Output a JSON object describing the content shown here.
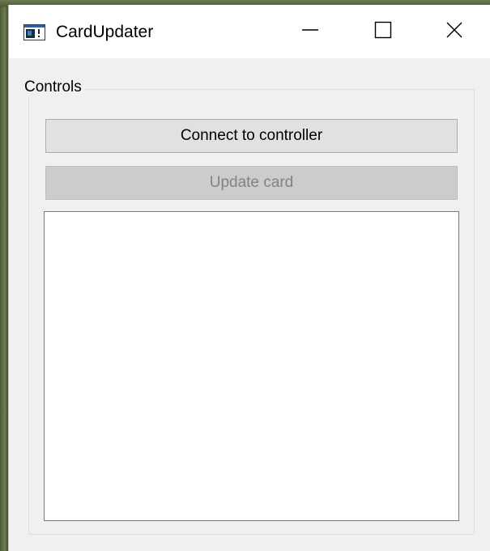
{
  "window": {
    "title": "CardUpdater",
    "icon": "app-window-icon"
  },
  "titlebar_buttons": {
    "minimize": "minimize-icon",
    "maximize": "maximize-icon",
    "close": "close-icon"
  },
  "controls_group": {
    "title": "Controls",
    "connect_button": {
      "label": "Connect to controller",
      "enabled": true
    },
    "update_button": {
      "label": "Update card",
      "enabled": false
    },
    "log_text": ""
  },
  "colors": {
    "window_bg": "#f0f0f0",
    "titlebar_bg": "#ffffff",
    "button_bg": "#e1e1e1",
    "button_disabled_bg": "#cccccc",
    "button_disabled_text": "#838383"
  }
}
